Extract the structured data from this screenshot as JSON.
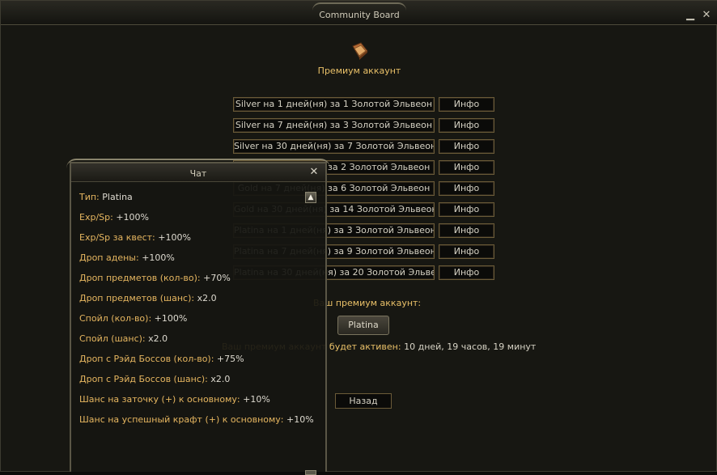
{
  "window": {
    "title": "Community Board"
  },
  "page": {
    "title": "Премиум аккаунт"
  },
  "options": [
    {
      "label": "Silver на 1 дней(ня) за 1 Золотой Эльвеон",
      "info": "Инфо"
    },
    {
      "label": "Silver на 7 дней(ня) за 3 Золотой Эльвеон",
      "info": "Инфо"
    },
    {
      "label": "Silver на 30 дней(ня) за 7 Золотой Эльвеон",
      "info": "Инфо"
    },
    {
      "label": "Gold на 1 дней(ня) за 2 Золотой Эльвеон",
      "info": "Инфо"
    },
    {
      "label": "Gold на 7 дней(ня) за 6 Золотой Эльвеон",
      "info": "Инфо"
    },
    {
      "label": "Gold на 30 дней(ня) за 14 Золотой Эльвеон",
      "info": "Инфо"
    },
    {
      "label": "Platina на 1 дней(ня) за 3 Золотой Эльвеон",
      "info": "Инфо"
    },
    {
      "label": "Platina на 7 дней(ня) за 9 Золотой Эльвеон",
      "info": "Инфо"
    },
    {
      "label": "Platina на 30 дней(ня) за 20 Золотой Эльвеон",
      "info": "Инфо"
    }
  ],
  "status": {
    "label": "Ваш премиум аккаунт:",
    "plan": "Platina",
    "expires_label": "Ваш премиум аккаунт будет активен:",
    "expires_value": "10 дней, 19 часов, 19 минут"
  },
  "back_label": "Назад",
  "chat": {
    "title": "Чат",
    "lines": [
      {
        "key": "Тип:",
        "value": "Platina"
      },
      {
        "key": "Exp/Sp:",
        "value": "+100%"
      },
      {
        "key": "Exp/Sp за квест:",
        "value": "+100%"
      },
      {
        "key": "Дроп адены:",
        "value": "+100%"
      },
      {
        "key": "Дроп предметов (кол-во):",
        "value": "+70%"
      },
      {
        "key": "Дроп предметов (шанс):",
        "value": "x2.0"
      },
      {
        "key": "Спойл (кол-во):",
        "value": "+100%"
      },
      {
        "key": "Спойл (шанс):",
        "value": "x2.0"
      },
      {
        "key": "Дроп с Рэйд Боссов (кол-во):",
        "value": "+75%"
      },
      {
        "key": "Дроп с Рэйд Боссов (шанс):",
        "value": "x2.0"
      },
      {
        "key": "Шанс на заточку (+) к основному:",
        "value": "+10%"
      },
      {
        "key": "Шанс на успешный крафт (+) к основному:",
        "value": "+10%"
      }
    ]
  },
  "colors": {
    "accent_gold": "#e9c068",
    "border": "#6b5b38"
  }
}
